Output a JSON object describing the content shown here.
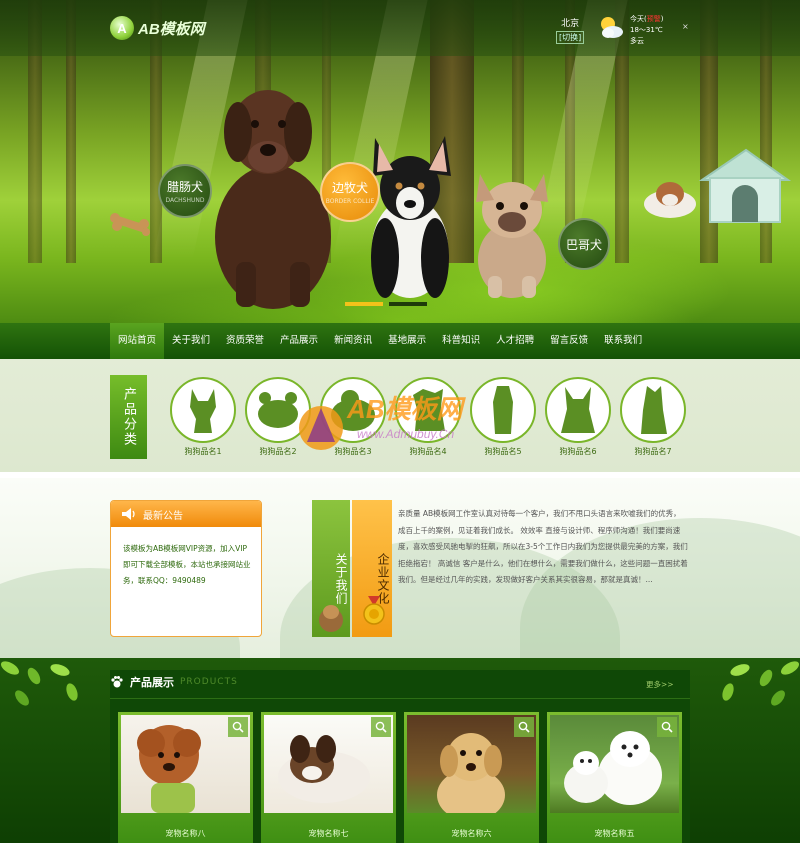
{
  "header": {
    "logo_mark": "A",
    "logo_text": "AB模板网",
    "city": "北京",
    "city_switch": "[切换]",
    "weather_day": "今天(",
    "weather_alert": "预警",
    "weather_day_end": ")",
    "weather_temp": "18～31℃",
    "weather_desc": "多云",
    "weather_close": "×"
  },
  "hero": {
    "badges": [
      {
        "label": "腊肠犬",
        "sub": "DACHSHUND"
      },
      {
        "label": "边牧犬",
        "sub": "BORDER COLLIE"
      },
      {
        "label": "巴哥犬",
        "sub": ""
      }
    ],
    "slides": [
      true,
      false
    ]
  },
  "nav": {
    "items": [
      "网站首页",
      "关于我们",
      "资质荣誉",
      "产品展示",
      "新闻资讯",
      "基地展示",
      "科普知识",
      "人才招聘",
      "留言反馈",
      "联系我们"
    ]
  },
  "categories": {
    "title": "产品分类",
    "items": [
      "狗狗品名1",
      "狗狗品名2",
      "狗狗品名3",
      "狗狗品名4",
      "狗狗品名5",
      "狗狗品名6",
      "狗狗品名7"
    ]
  },
  "watermark": {
    "brand": "AB模板网",
    "url": "www.Admubuy.Cn"
  },
  "notice": {
    "title": "最新公告",
    "body": "该模板为AB模板网VIP资源，加入VIP即可下载全部模板，本站也承接网站业务，联系QQ：9490489"
  },
  "about": {
    "tab_about": "关于我们",
    "tab_culture": "企业文化",
    "text": "亲质量 AB模板网工作室认真对待每一个客户，我们不甩口头语言来吹嘘我们的优秀，成百上千的案例，见证着我们成长。 效效率 直接与设计师、程序师沟通！我们要尚速度，喜欢感受风驰电掣的狂飙，所以在3-5个工作日内我们为您提供最完美的方案，我们拒绝拖宕！ 高诚信 客户是什么，他们在想什么，需要我们做什么，这些问题一直困扰着我们。但是经过几年的实践，发现做好客户关系其实很容易，那就是真诚！..."
  },
  "products": {
    "title": "产品展示",
    "subtitle": "PRODUCTS",
    "more": "更多>>",
    "items": [
      {
        "name": "宠物名称八",
        "icon": "zoom-icon"
      },
      {
        "name": "宠物名称七",
        "icon": "zoom-icon"
      },
      {
        "name": "宠物名称六",
        "icon": "zoom-icon"
      },
      {
        "name": "宠物名称五",
        "icon": "zoom-icon"
      }
    ]
  },
  "colors": {
    "brand_green": "#3e8a12",
    "nav_green": "#145206",
    "accent_orange": "#f08a0a",
    "alert_red": "#ff3333"
  }
}
